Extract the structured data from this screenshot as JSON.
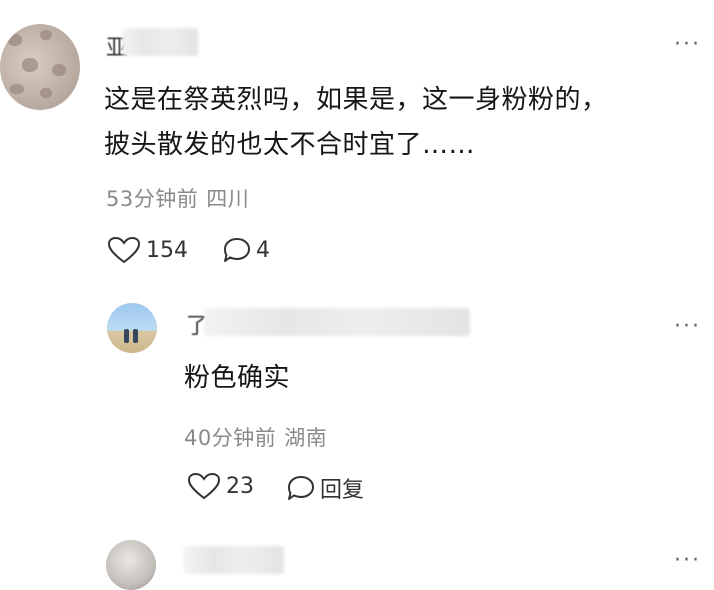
{
  "comments": [
    {
      "name_fragment": "亚",
      "text_line1": "这是在祭英烈吗，如果是，这一身粉粉的，",
      "text_line2": "披头散发的也太不合时宜了……",
      "time": "53分钟前",
      "location": "四川",
      "likes": "154",
      "replies": "4",
      "more": "···"
    },
    {
      "name_fragment": "了",
      "text": "粉色确实",
      "time": "40分钟前",
      "location": "湖南",
      "likes": "23",
      "reply_label": "回复",
      "more": "···"
    },
    {
      "more": "···"
    }
  ],
  "icons": {
    "like": "heart-outline-icon",
    "comment": "speech-bubble-icon",
    "more": "more-dots-icon"
  },
  "colors": {
    "text": "#161616",
    "meta": "#8a8a8a",
    "icon": "#333333"
  }
}
